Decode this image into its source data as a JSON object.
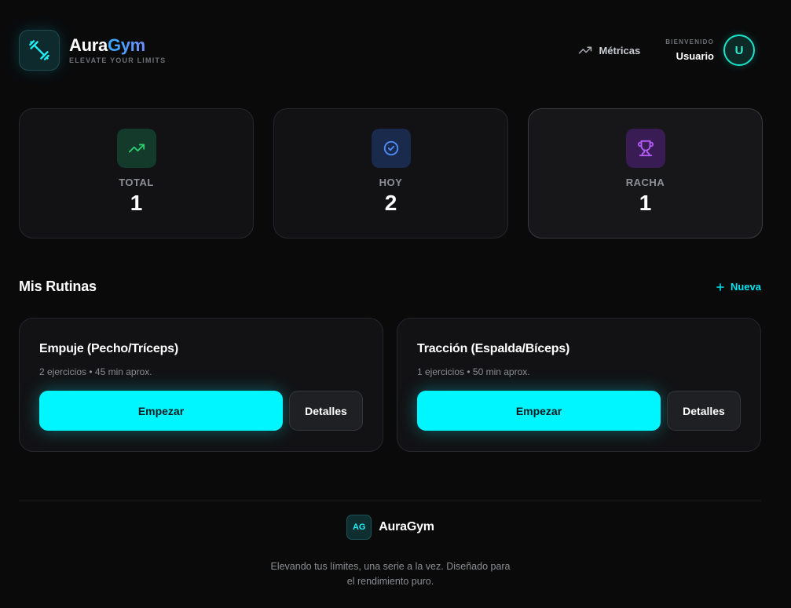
{
  "brand": {
    "name_main": "Aura",
    "name_accent": "Gym",
    "tagline": "ELEVATE YOUR LIMITS",
    "logo_icon": "dumbbell-icon"
  },
  "header": {
    "metrics_label": "Métricas",
    "metrics_icon": "trending-up-icon",
    "welcome_label": "BIENVENIDO",
    "username": "Usuario",
    "avatar_initial": "U"
  },
  "stats": [
    {
      "label": "TOTAL",
      "value": "1",
      "icon": "trending-up-icon",
      "color": "#2ecc71"
    },
    {
      "label": "HOY",
      "value": "2",
      "icon": "check-circle-icon",
      "color": "#3b82f6"
    },
    {
      "label": "RACHA",
      "value": "1",
      "icon": "trophy-icon",
      "color": "#a855f7"
    }
  ],
  "routines_section": {
    "title": "Mis Rutinas",
    "new_label": "Nueva",
    "routines": [
      {
        "title": "Empuje (Pecho/Tríceps)",
        "meta": "2 ejercicios • 45 min aprox.",
        "start_label": "Empezar",
        "details_label": "Detalles"
      },
      {
        "title": "Tracción (Espalda/Bíceps)",
        "meta": "1 ejercicios • 50 min aprox.",
        "start_label": "Empezar",
        "details_label": "Detalles"
      }
    ]
  },
  "footer": {
    "badge": "AG",
    "name": "AuraGym",
    "text": "Elevando tus límites, una serie a la vez. Diseñado para el rendimiento puro."
  },
  "colors": {
    "accent": "#00f6ff",
    "background": "#0a0a0b",
    "card": "#121214"
  }
}
